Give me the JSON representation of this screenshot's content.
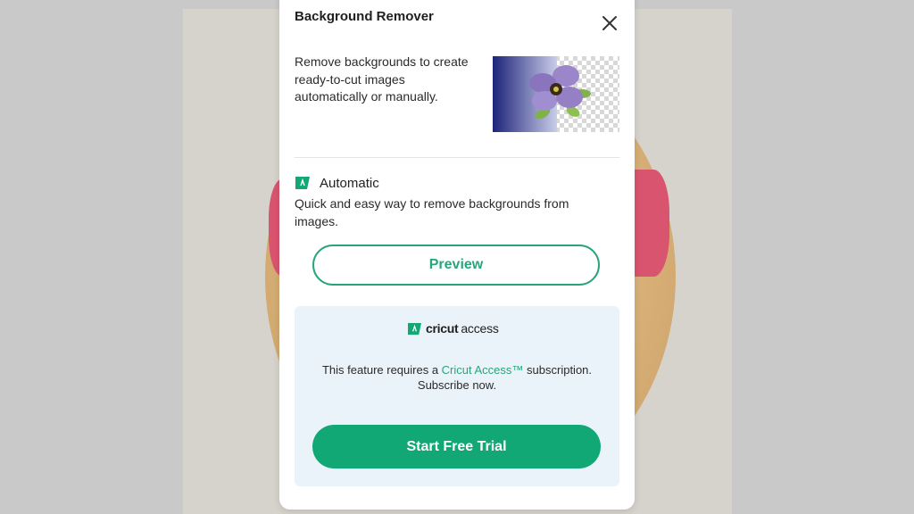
{
  "dialog": {
    "title": "Background Remover",
    "description": "Remove backgrounds to create ready-to-cut images automatically or manually.",
    "automatic": {
      "label": "Automatic",
      "description": "Quick and easy way to remove backgrounds from images.",
      "preview_label": "Preview"
    },
    "access": {
      "logo_brand": "cricut",
      "logo_product": "access",
      "requirement_prefix": "This feature requires a ",
      "requirement_link": "Cricut Access™",
      "requirement_suffix": " subscription.",
      "subscribe_text": "Subscribe now.",
      "trial_label": "Start Free Trial"
    }
  },
  "colors": {
    "accent": "#2aa57a",
    "trial_button": "#11a875",
    "access_panel": "#eaf2fa"
  },
  "icons": [
    "close-icon",
    "access-badge-icon",
    "flower-thumbnail"
  ]
}
